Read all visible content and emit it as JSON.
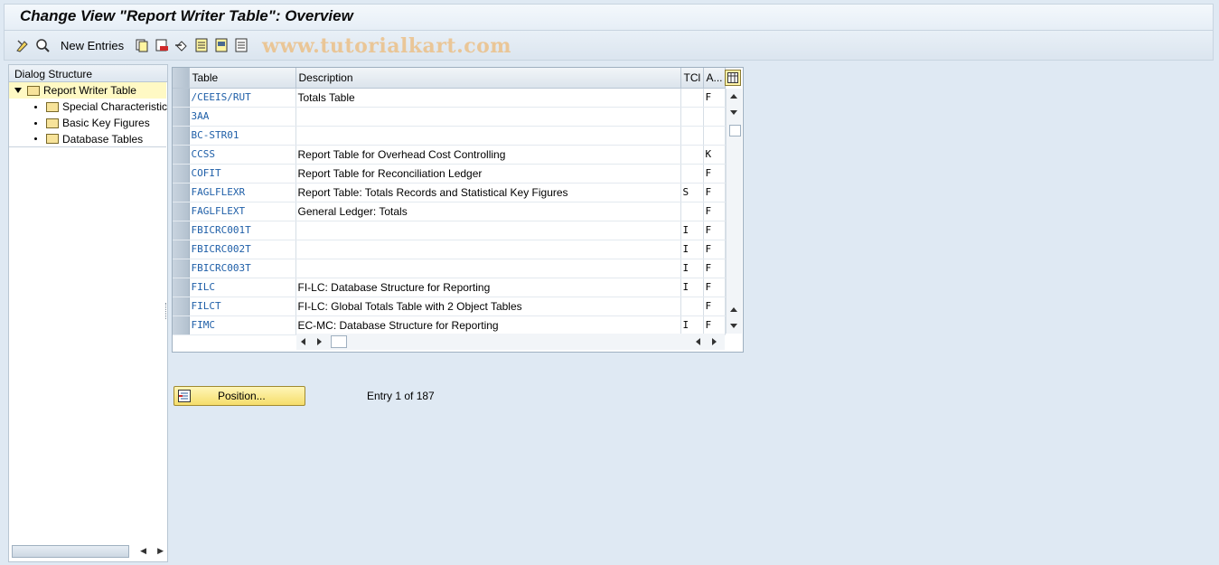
{
  "window": {
    "title": "Change View \"Report Writer Table\": Overview"
  },
  "toolbar": {
    "new_entries_label": "New Entries",
    "watermark": "www.tutorialkart.com"
  },
  "dialog_structure": {
    "header": "Dialog Structure",
    "root": "Report Writer Table",
    "children": [
      "Special Characteristic",
      "Basic Key Figures",
      "Database Tables"
    ]
  },
  "table": {
    "columns": [
      "Table",
      "Description",
      "TCl",
      "A..."
    ],
    "rows": [
      {
        "table": "/CEEIS/RUT",
        "description": "Totals Table",
        "tcl": "",
        "a": "F"
      },
      {
        "table": "3AA",
        "description": "",
        "tcl": "",
        "a": ""
      },
      {
        "table": "BC-STR01",
        "description": "",
        "tcl": "",
        "a": ""
      },
      {
        "table": "CCSS",
        "description": "Report Table for Overhead Cost Controlling",
        "tcl": "",
        "a": "K"
      },
      {
        "table": "COFIT",
        "description": "Report Table for Reconciliation Ledger",
        "tcl": "",
        "a": "F"
      },
      {
        "table": "FAGLFLEXR",
        "description": "Report Table: Totals Records and Statistical Key Figures",
        "tcl": "S",
        "a": "F"
      },
      {
        "table": "FAGLFLEXT",
        "description": "General Ledger: Totals",
        "tcl": "",
        "a": "F"
      },
      {
        "table": "FBICRC001T",
        "description": "",
        "tcl": "I",
        "a": "F"
      },
      {
        "table": "FBICRC002T",
        "description": "",
        "tcl": "I",
        "a": "F"
      },
      {
        "table": "FBICRC003T",
        "description": "",
        "tcl": "I",
        "a": "F"
      },
      {
        "table": "FILC",
        "description": "FI-LC: Database Structure for Reporting",
        "tcl": "I",
        "a": "F"
      },
      {
        "table": "FILCT",
        "description": "FI-LC: Global Totals Table with 2 Object Tables",
        "tcl": "",
        "a": "F"
      },
      {
        "table": "FIMC",
        "description": "EC-MC: Database Structure for Reporting",
        "tcl": "I",
        "a": "F"
      }
    ]
  },
  "footer": {
    "position_label": "Position...",
    "entry_info": "Entry 1 of 187"
  }
}
